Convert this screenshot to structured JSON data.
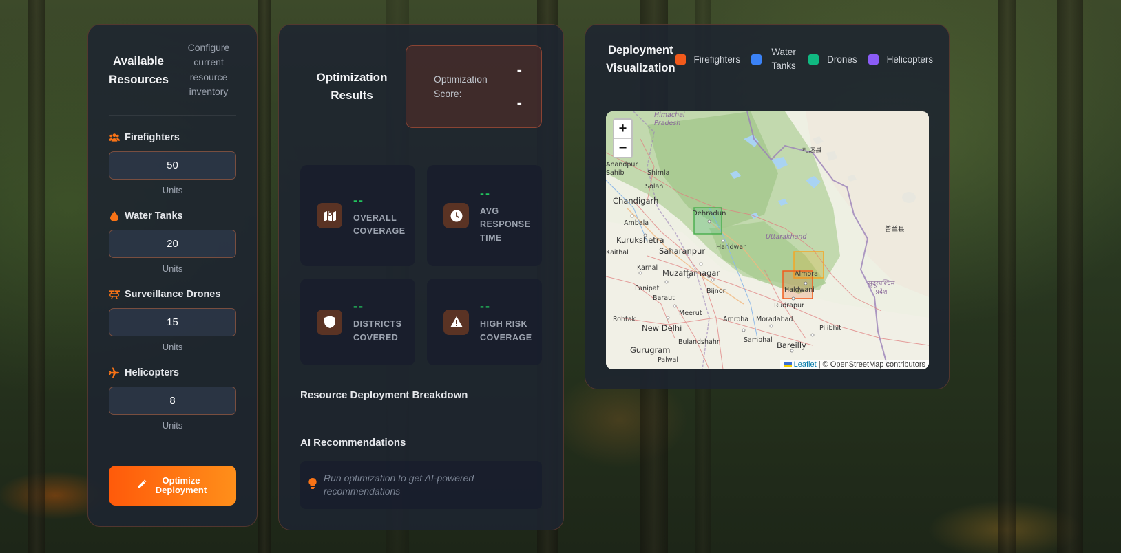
{
  "resources_panel": {
    "title": "Available Resources",
    "subtitle": "Configure current resource inventory",
    "items": [
      {
        "label": "Firefighters",
        "value": "50",
        "unit": "Units",
        "icon": "users-icon"
      },
      {
        "label": "Water Tanks",
        "value": "20",
        "unit": "Units",
        "icon": "droplet-icon"
      },
      {
        "label": "Surveillance Drones",
        "value": "15",
        "unit": "Units",
        "icon": "drone-icon"
      },
      {
        "label": "Helicopters",
        "value": "8",
        "unit": "Units",
        "icon": "plane-icon"
      }
    ],
    "optimize_button": "Optimize Deployment"
  },
  "results_panel": {
    "title": "Optimization Results",
    "score_label": "Optimization Score:",
    "score_value_1": "-",
    "score_value_2": "-",
    "metrics": [
      {
        "value": "--",
        "label": "OVERALL COVERAGE",
        "icon": "map-icon"
      },
      {
        "value": "--",
        "label": "AVG RESPONSE TIME",
        "icon": "clock-icon"
      },
      {
        "value": "--",
        "label": "DISTRICTS COVERED",
        "icon": "shield-icon"
      },
      {
        "value": "--",
        "label": "HIGH RISK COVERAGE",
        "icon": "warning-icon"
      }
    ],
    "breakdown_title": "Resource Deployment Breakdown",
    "ai_title": "AI Recommendations",
    "ai_placeholder": "Run optimization to get AI-powered recommendations"
  },
  "visualization_panel": {
    "title": "Deployment Visualization",
    "legend": [
      {
        "label": "Firefighters",
        "color": "#f25a1b"
      },
      {
        "label": "Water Tanks",
        "color": "#3b82f6"
      },
      {
        "label": "Drones",
        "color": "#10b981"
      },
      {
        "label": "Helicopters",
        "color": "#8b5cf6"
      }
    ],
    "map": {
      "zoom_in": "+",
      "zoom_out": "−",
      "attribution_link": "Leaflet",
      "attribution_text": "| © OpenStreetMap contributors",
      "labels": {
        "himachal": "Himachal Pradesh",
        "anandpur": "Anandpur Sahib",
        "shimla": "Shimla",
        "solan": "Solan",
        "chandigarh": "Chandigarh",
        "ambala": "Ambala",
        "kurukshetra": "Kurukshetra",
        "dehradun": "Dehradun",
        "uttarakhand": "Uttarakhand",
        "haridwar": "Haridwar",
        "saharanpur": "Saharanpur",
        "kaithal": "Kaithal",
        "karnal": "Karnal",
        "muzaffarnagar": "Muzaffarnagar",
        "almora": "Almora",
        "haldwani": "Haldwani",
        "panipat": "Panipat",
        "baraut": "Baraut",
        "bijnor": "Bijnor",
        "rudrapur": "Rudrapur",
        "meerut": "Meerut",
        "rohtak": "Rohtak",
        "new_delhi": "New Delhi",
        "amroha": "Amroha",
        "moradabad": "Moradabad",
        "pilibhit": "Pilibhit",
        "bulandshahr": "Bulandshahr",
        "sambhal": "Sambhal",
        "bareilly": "Bareilly",
        "gurugram": "Gurugram",
        "palwal": "Palwal",
        "sudurpashchim": "सुदूरपश्चिम प्रदेश",
        "tibet1": "札达县",
        "tibet2": "普兰县"
      }
    }
  }
}
